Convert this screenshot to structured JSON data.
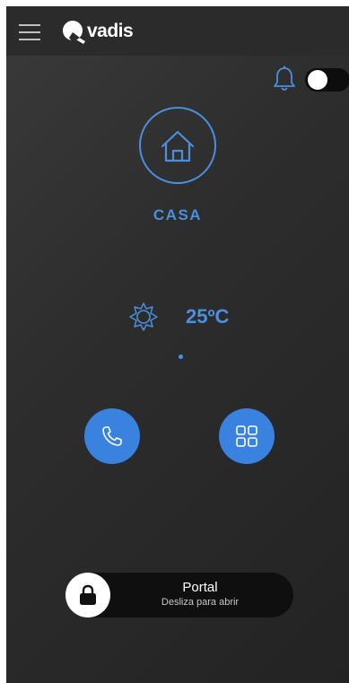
{
  "header": {
    "brand_name": "vadis",
    "menu_icon": "hamburger-menu-icon",
    "logo_icon": "qvadis-q-logo"
  },
  "controls": {
    "bell_icon": "bell-icon",
    "notifications_toggle": "off"
  },
  "place": {
    "icon": "home-icon",
    "label": "CASA"
  },
  "weather": {
    "icon": "sun-icon",
    "temperature": "25ºC"
  },
  "actions": {
    "call_icon": "phone-icon",
    "grid_icon": "grid-icon"
  },
  "unlock_slider": {
    "title": "Portal",
    "subtitle": "Desliza para abrir",
    "handle_icon": "lock-icon"
  },
  "colors": {
    "accent": "#3a82e0",
    "accent_text": "#4a8fe0",
    "background": "#2d2d2d",
    "slider_bg": "#0f0f0f"
  }
}
